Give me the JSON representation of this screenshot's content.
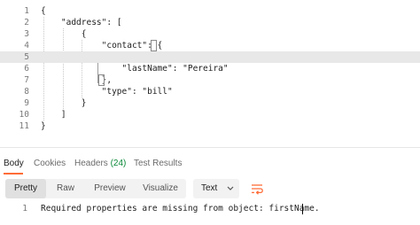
{
  "request_body": {
    "lines": [
      {
        "num": "1",
        "text": "{"
      },
      {
        "num": "2",
        "text": "    \"address\": ["
      },
      {
        "num": "3",
        "text": "        {"
      },
      {
        "num": "4",
        "text": "            \"contact\": {"
      },
      {
        "num": "5",
        "text": ""
      },
      {
        "num": "6",
        "text": "                \"lastName\": \"Pereira\""
      },
      {
        "num": "7",
        "text": "            },"
      },
      {
        "num": "8",
        "text": "            \"type\": \"bill\""
      },
      {
        "num": "9",
        "text": "        }"
      },
      {
        "num": "10",
        "text": "    ]"
      },
      {
        "num": "11",
        "text": "}"
      }
    ]
  },
  "response_tabs": [
    {
      "label": "Body"
    },
    {
      "label": "Cookies"
    },
    {
      "label": "Headers",
      "count": "(24)"
    },
    {
      "label": "Test Results"
    }
  ],
  "view_modes": [
    "Pretty",
    "Raw",
    "Preview",
    "Visualize"
  ],
  "format_select": {
    "value": "Text"
  },
  "response_body": {
    "line_num": "1",
    "text": "Required properties are missing from object: firstName."
  },
  "colors": {
    "accent": "#ff6c37",
    "count_green": "#0b8a3a"
  },
  "icons": {
    "chevron": "chevron-down-icon",
    "wrap": "wrap-lines-icon"
  }
}
